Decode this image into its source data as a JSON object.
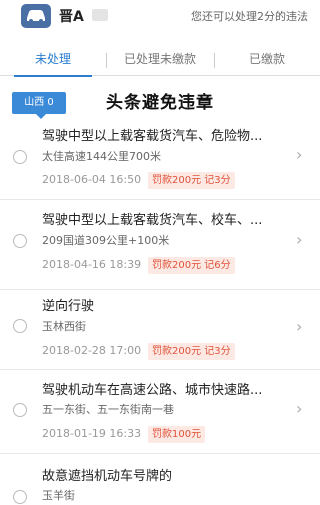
{
  "header": {
    "plate": "晋A",
    "hint": "您还可以处理2分的违法"
  },
  "tabs": [
    {
      "label": "未处理"
    },
    {
      "label": "已处理未缴款"
    },
    {
      "label": "已缴款"
    }
  ],
  "province_badge": "山西 0",
  "watermark": "头条避免违章",
  "violations": [
    {
      "title": "驾驶中型以上载客载货汽车、危险物...",
      "location": "太佳高速144公里700米",
      "datetime": "2018-06-04 16:50",
      "penalty": "罚款200元 记3分"
    },
    {
      "title": "驾驶中型以上载客载货汽车、校车、...",
      "location": "209国道309公里+100米",
      "datetime": "2018-04-16 18:39",
      "penalty": "罚款200元 记6分"
    },
    {
      "title": "逆向行驶",
      "location": "玉林西街",
      "datetime": "2018-02-28 17:00",
      "penalty": "罚款200元 记3分"
    },
    {
      "title": "驾驶机动车在高速公路、城市快速路...",
      "location": "五一东街、五一东街南一巷",
      "datetime": "2018-01-19 16:33",
      "penalty": "罚款100元"
    },
    {
      "title": "故意遮挡机动车号牌的",
      "location": "玉羊街",
      "datetime": "",
      "penalty": ""
    }
  ],
  "icons": {
    "car": "car-icon",
    "radio": "radio-icon",
    "arrow": "chevron-right-icon"
  }
}
